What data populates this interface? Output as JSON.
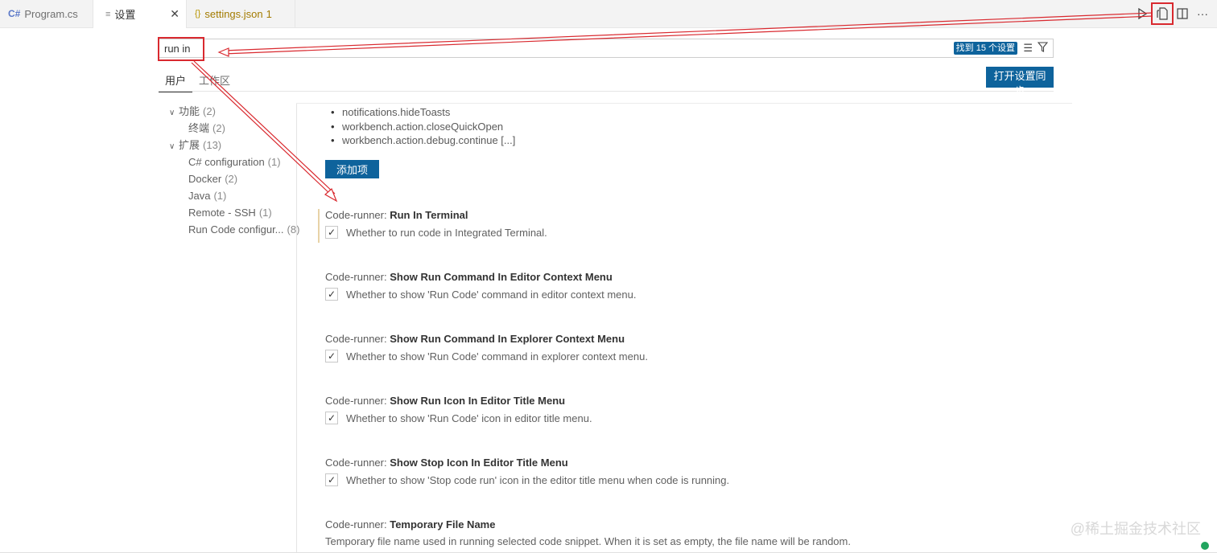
{
  "tabs": [
    {
      "icon": "C#",
      "label": "Program.cs"
    },
    {
      "icon": "≡",
      "label": "设置",
      "close": "✕"
    },
    {
      "icon": "{}",
      "label": "settings.json",
      "badge": "1"
    }
  ],
  "editor_actions": [
    "run-icon",
    "open-settings-json-icon",
    "split-editor-icon",
    "more-actions-icon"
  ],
  "search": {
    "value": "run in",
    "count_badge": "找到 15 个设置"
  },
  "scope_tabs": [
    "用户",
    "工作区"
  ],
  "sync_button": "打开设置同步",
  "toc": [
    {
      "label": "功能",
      "count": "(2)",
      "expanded": true,
      "level": 1
    },
    {
      "label": "终端",
      "count": "(2)",
      "level": 2
    },
    {
      "label": "扩展",
      "count": "(13)",
      "expanded": true,
      "level": 1
    },
    {
      "label": "C# configuration",
      "count": "(1)",
      "level": 2
    },
    {
      "label": "Docker",
      "count": "(2)",
      "level": 2
    },
    {
      "label": "Java",
      "count": "(1)",
      "level": 2
    },
    {
      "label": "Remote - SSH",
      "count": "(1)",
      "level": 2
    },
    {
      "label": "Run Code configur...",
      "count": "(8)",
      "level": 2
    }
  ],
  "list_items": [
    "notifications.hideToasts",
    "workbench.action.closeQuickOpen",
    "workbench.action.debug.continue [...]"
  ],
  "add_button": "添加项",
  "settings": [
    {
      "category": "Code-runner: ",
      "name": "Run In Terminal",
      "description": "Whether to run code in Integrated Terminal.",
      "checked": true
    },
    {
      "category": "Code-runner: ",
      "name": "Show Run Command In Editor Context Menu",
      "description": "Whether to show 'Run Code' command in editor context menu.",
      "checked": true
    },
    {
      "category": "Code-runner: ",
      "name": "Show Run Command In Explorer Context Menu",
      "description": "Whether to show 'Run Code' command in explorer context menu.",
      "checked": true
    },
    {
      "category": "Code-runner: ",
      "name": "Show Run Icon In Editor Title Menu",
      "description": "Whether to show 'Run Code' icon in editor title menu.",
      "checked": true
    },
    {
      "category": "Code-runner: ",
      "name": "Show Stop Icon In Editor Title Menu",
      "description": "Whether to show 'Stop code run' icon in the editor title menu when code is running.",
      "checked": true
    },
    {
      "category": "Code-runner: ",
      "name": "Temporary File Name",
      "description": "Temporary file name used in running selected code snippet. When it is set as empty, the file name will be random."
    }
  ],
  "checkmark": "✓",
  "watermark": "@稀土掘金技术社区",
  "colors": {
    "accent": "#0e639c",
    "annotation": "#d9292f",
    "status": "#22a55f"
  }
}
